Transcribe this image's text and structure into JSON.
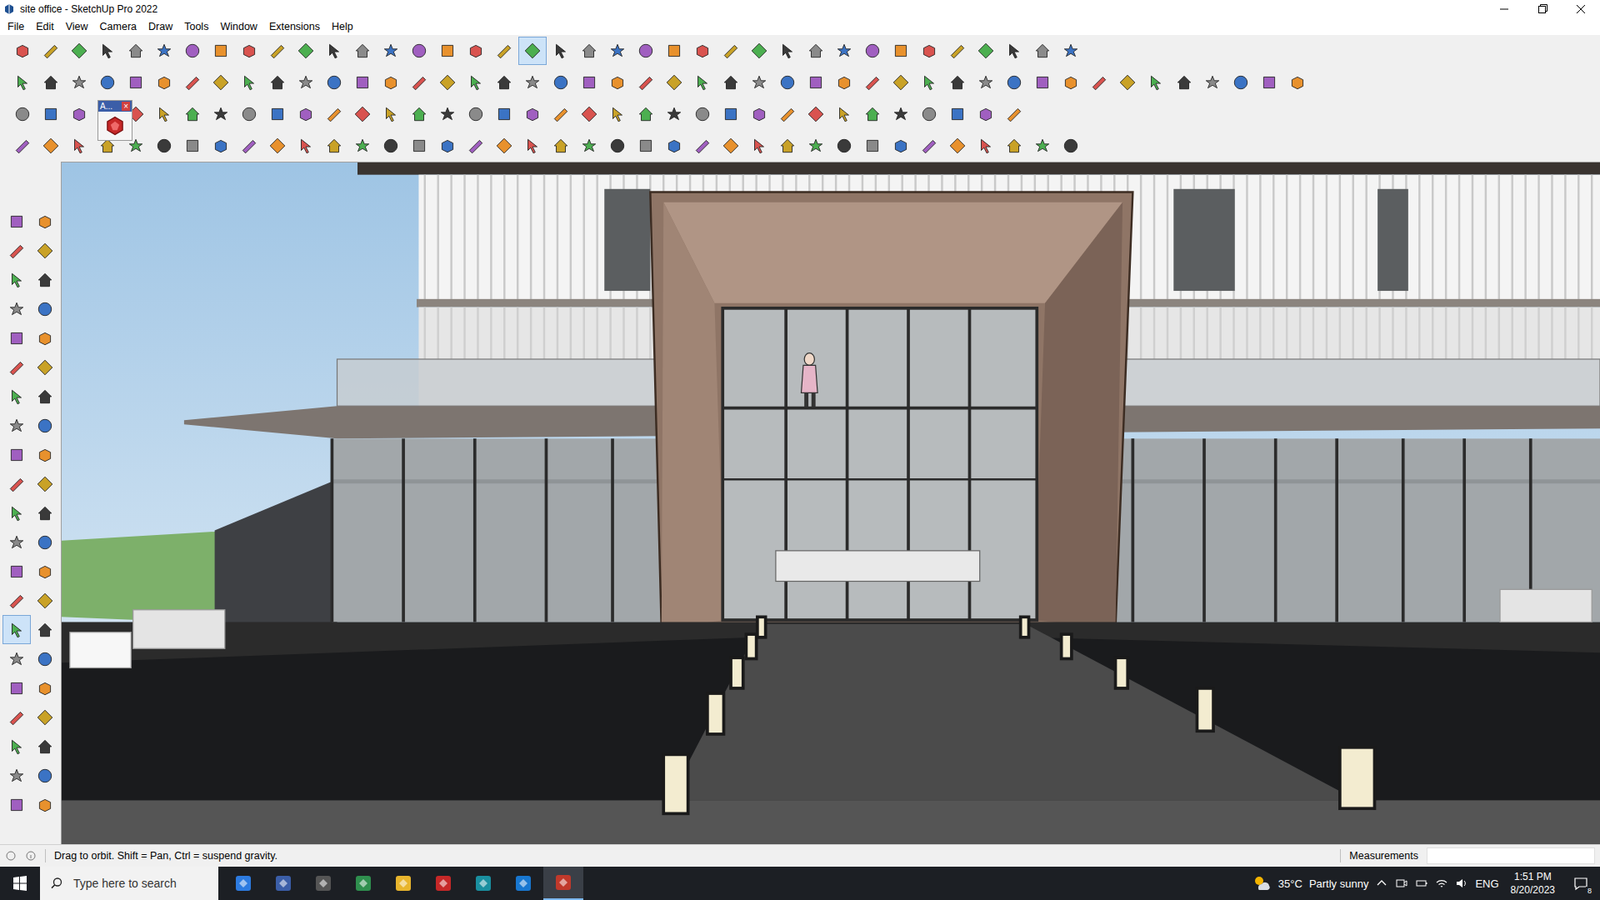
{
  "window": {
    "title": "site office - SketchUp Pro 2022"
  },
  "menus": [
    "File",
    "Edit",
    "View",
    "Camera",
    "Draw",
    "Tools",
    "Window",
    "Extensions",
    "Help"
  ],
  "toolbar_rows": [
    {
      "buttons": [
        {
          "selected": false
        },
        {
          "selected": false
        },
        {
          "selected": false
        },
        {
          "selected": false
        },
        {
          "selected": false
        },
        {
          "selected": false
        },
        {
          "selected": false
        },
        {
          "selected": false
        },
        {
          "selected": false
        },
        {
          "selected": false
        },
        {
          "selected": false
        },
        {
          "selected": false
        },
        {
          "selected": false
        },
        {
          "selected": false
        },
        {
          "selected": false
        },
        {
          "selected": false
        },
        {
          "selected": false
        },
        {
          "selected": false
        },
        {
          "selected": true
        },
        {
          "selected": false
        },
        {
          "selected": false
        },
        {
          "selected": false
        },
        {
          "selected": false
        },
        {
          "selected": false
        },
        {
          "selected": false
        },
        {
          "selected": false
        },
        {
          "selected": false
        },
        {
          "selected": false
        },
        {
          "selected": false
        },
        {
          "selected": false
        },
        {
          "selected": false
        },
        {
          "selected": false
        },
        {
          "selected": false
        },
        {
          "selected": false
        },
        {
          "selected": false
        },
        {
          "selected": false
        },
        {
          "selected": false
        },
        {
          "selected": false
        }
      ]
    },
    {
      "buttons": [
        {
          "selected": false
        },
        {
          "selected": false
        },
        {
          "selected": false
        },
        {
          "selected": false
        },
        {
          "selected": false
        },
        {
          "selected": false
        },
        {
          "selected": false
        },
        {
          "selected": false
        },
        {
          "selected": false
        },
        {
          "selected": false
        },
        {
          "selected": false
        },
        {
          "selected": false
        },
        {
          "selected": false
        },
        {
          "selected": false
        },
        {
          "selected": false
        },
        {
          "selected": false
        },
        {
          "selected": false
        },
        {
          "selected": false
        },
        {
          "selected": false
        },
        {
          "selected": false
        },
        {
          "selected": false
        },
        {
          "selected": false
        },
        {
          "selected": false
        },
        {
          "selected": false
        },
        {
          "selected": false
        },
        {
          "selected": false
        },
        {
          "selected": false
        },
        {
          "selected": false
        },
        {
          "selected": false
        },
        {
          "selected": false
        },
        {
          "selected": false
        },
        {
          "selected": false
        },
        {
          "selected": false
        },
        {
          "selected": false
        },
        {
          "selected": false
        },
        {
          "selected": false
        },
        {
          "selected": false
        },
        {
          "selected": false
        },
        {
          "selected": false
        },
        {
          "selected": false
        },
        {
          "selected": false
        },
        {
          "selected": false
        },
        {
          "selected": false
        },
        {
          "selected": false
        },
        {
          "selected": false
        },
        {
          "selected": false
        }
      ]
    },
    {
      "buttons": [
        {
          "selected": false
        },
        {
          "selected": false
        },
        {
          "selected": false
        },
        {
          "selected": false
        },
        {
          "selected": false
        },
        {
          "selected": false
        },
        {
          "selected": false
        },
        {
          "selected": false
        },
        {
          "selected": false
        },
        {
          "selected": false
        },
        {
          "selected": false
        },
        {
          "selected": false
        },
        {
          "selected": false
        },
        {
          "selected": false
        },
        {
          "selected": false
        },
        {
          "selected": false
        },
        {
          "selected": false
        },
        {
          "selected": false
        },
        {
          "selected": false
        },
        {
          "selected": false
        },
        {
          "selected": false
        },
        {
          "selected": false
        },
        {
          "selected": false
        },
        {
          "selected": false
        },
        {
          "selected": false
        },
        {
          "selected": false
        },
        {
          "selected": false
        },
        {
          "selected": false
        },
        {
          "selected": false
        },
        {
          "selected": false
        },
        {
          "selected": false
        },
        {
          "selected": false
        },
        {
          "selected": false
        },
        {
          "selected": false
        },
        {
          "selected": false
        },
        {
          "selected": false
        }
      ]
    },
    {
      "buttons": [
        {
          "selected": false
        },
        {
          "selected": false
        },
        {
          "selected": false
        },
        {
          "selected": false
        },
        {
          "selected": false
        },
        {
          "selected": false
        },
        {
          "selected": false
        },
        {
          "selected": false
        },
        {
          "selected": false
        },
        {
          "selected": false
        },
        {
          "selected": false
        },
        {
          "selected": false
        },
        {
          "selected": false
        },
        {
          "selected": false
        },
        {
          "selected": false
        },
        {
          "selected": false
        },
        {
          "selected": false
        },
        {
          "selected": false
        },
        {
          "selected": false
        },
        {
          "selected": false
        },
        {
          "selected": false
        },
        {
          "selected": false
        },
        {
          "selected": false
        },
        {
          "selected": false
        },
        {
          "selected": false
        },
        {
          "selected": false
        },
        {
          "selected": false
        },
        {
          "selected": false
        },
        {
          "selected": false
        },
        {
          "selected": false
        },
        {
          "selected": false
        },
        {
          "selected": false
        },
        {
          "selected": false
        },
        {
          "selected": false
        },
        {
          "selected": false
        },
        {
          "selected": false
        },
        {
          "selected": false
        },
        {
          "selected": false
        }
      ]
    }
  ],
  "floating_toolbar": {
    "label": "A...",
    "close": "×"
  },
  "tool_palette": [
    {
      "selected": false
    },
    {
      "selected": false
    },
    {
      "selected": false
    },
    {
      "selected": false
    },
    {
      "selected": false
    },
    {
      "selected": false
    },
    {
      "selected": false
    },
    {
      "selected": false
    },
    {
      "selected": false
    },
    {
      "selected": false
    },
    {
      "selected": false
    },
    {
      "selected": false
    },
    {
      "selected": false
    },
    {
      "selected": false
    },
    {
      "selected": false
    },
    {
      "selected": false
    },
    {
      "selected": false
    },
    {
      "selected": false
    },
    {
      "selected": false
    },
    {
      "selected": false
    },
    {
      "selected": false
    },
    {
      "selected": false
    },
    {
      "selected": false
    },
    {
      "selected": false
    },
    {
      "selected": false
    },
    {
      "selected": false
    },
    {
      "selected": false
    },
    {
      "selected": false
    },
    {
      "selected": true
    },
    {
      "selected": false
    },
    {
      "selected": false
    },
    {
      "selected": false
    },
    {
      "selected": false
    },
    {
      "selected": false
    },
    {
      "selected": false
    },
    {
      "selected": false
    },
    {
      "selected": false
    },
    {
      "selected": false
    },
    {
      "selected": false
    },
    {
      "selected": false
    },
    {
      "selected": false
    },
    {
      "selected": false
    }
  ],
  "status_bar": {
    "message": "Drag to orbit. Shift = Pan, Ctrl = suspend gravity.",
    "measurements_label": "Measurements"
  },
  "taskbar": {
    "search_placeholder": "Type here to search",
    "apps": [
      {
        "selected": false
      },
      {
        "selected": false
      },
      {
        "selected": false
      },
      {
        "selected": false
      },
      {
        "selected": false
      },
      {
        "selected": false
      },
      {
        "selected": false
      },
      {
        "selected": false
      },
      {
        "selected": true
      }
    ],
    "weather": {
      "temperature": "35°C",
      "description": "Partly sunny"
    },
    "language": "ENG",
    "time": "1:51 PM",
    "date": "8/20/2023",
    "notifications": "8"
  }
}
